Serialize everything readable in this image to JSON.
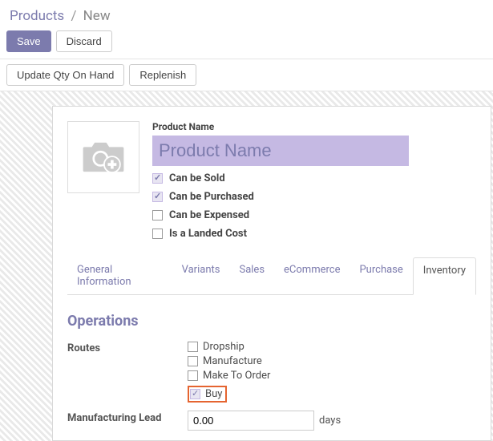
{
  "breadcrumb": {
    "parent": "Products",
    "current": "New"
  },
  "toolbar": {
    "save": "Save",
    "discard": "Discard"
  },
  "actions": {
    "update_qty": "Update Qty On Hand",
    "replenish": "Replenish"
  },
  "product": {
    "name_label": "Product Name",
    "name_placeholder": "Product Name",
    "name_value": "",
    "checks": {
      "sold": {
        "label": "Can be Sold",
        "checked": true
      },
      "purchased": {
        "label": "Can be Purchased",
        "checked": true
      },
      "expensed": {
        "label": "Can be Expensed",
        "checked": false
      },
      "landed": {
        "label": "Is a Landed Cost",
        "checked": false
      }
    }
  },
  "tabs": {
    "general": "General Information",
    "variants": "Variants",
    "sales": "Sales",
    "ecommerce": "eCommerce",
    "purchase": "Purchase",
    "inventory": "Inventory"
  },
  "inventory": {
    "operations_heading": "Operations",
    "routes_label": "Routes",
    "routes": {
      "dropship": {
        "label": "Dropship",
        "checked": false
      },
      "manufacture": {
        "label": "Manufacture",
        "checked": false
      },
      "make_to_order": {
        "label": "Make To Order",
        "checked": false
      },
      "buy": {
        "label": "Buy",
        "checked": true
      }
    },
    "manuf_lead_label": "Manufacturing Lead",
    "manuf_lead_value": "0.00",
    "days_label": "days"
  }
}
